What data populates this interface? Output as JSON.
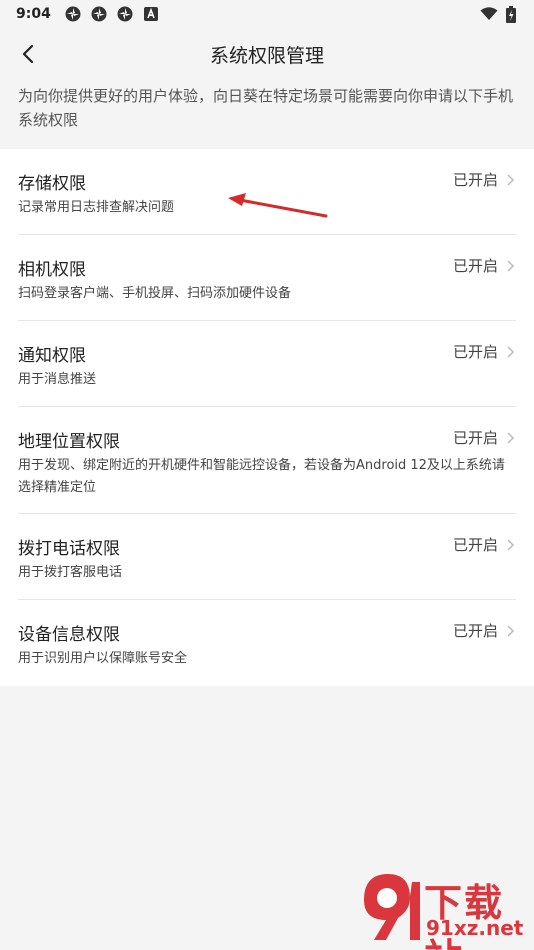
{
  "status_bar": {
    "time": "9:04",
    "left_icons": [
      "app-notification-icon",
      "app-notification-icon",
      "app-notification-icon",
      "a-notification-icon"
    ],
    "right_icons": [
      "wifi-icon",
      "battery-icon"
    ]
  },
  "header": {
    "title": "系统权限管理",
    "back_icon": "chevron-left-icon"
  },
  "intro": "为向你提供更好的用户体验，向日葵在特定场景可能需要向你申请以下手机系统权限",
  "permissions": [
    {
      "name": "存储权限",
      "desc": "记录常用日志排查解决问题",
      "status": "已开启"
    },
    {
      "name": "相机权限",
      "desc": "扫码登录客户端、手机投屏、扫码添加硬件设备",
      "status": "已开启"
    },
    {
      "name": "通知权限",
      "desc": "用于消息推送",
      "status": "已开启"
    },
    {
      "name": "地理位置权限",
      "desc": "用于发现、绑定附近的开机硬件和智能远控设备，若设备为Android 12及以上系统请选择精准定位",
      "status": "已开启"
    },
    {
      "name": "拨打电话权限",
      "desc": "用于拨打客服电话",
      "status": "已开启"
    },
    {
      "name": "设备信息权限",
      "desc": "用于识别用户以保障账号安全",
      "status": "已开启"
    }
  ],
  "watermark": {
    "top": "下载站",
    "bottom": "91xz.net"
  },
  "colors": {
    "background": "#f4f4f4",
    "card": "#ffffff",
    "annotation_arrow": "#d42a2a",
    "watermark": "#d9363e"
  }
}
